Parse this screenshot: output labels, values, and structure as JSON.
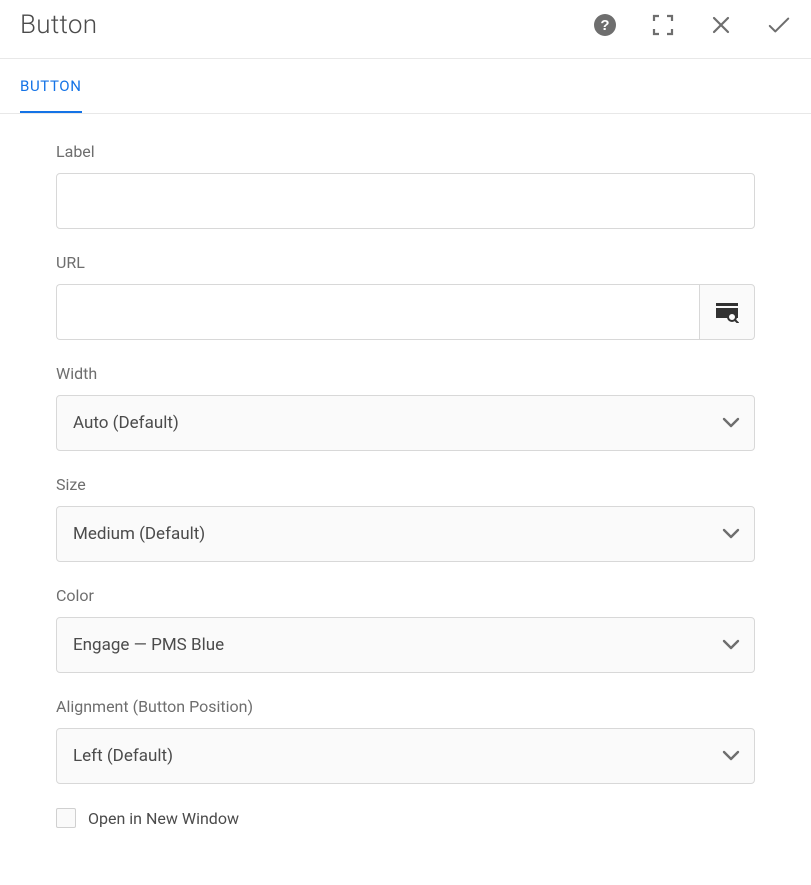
{
  "header": {
    "title": "Button"
  },
  "tabs": [
    {
      "label": "BUTTON",
      "active": true
    }
  ],
  "fields": {
    "label": {
      "label": "Label",
      "value": ""
    },
    "url": {
      "label": "URL",
      "value": ""
    },
    "width": {
      "label": "Width",
      "value": "Auto (Default)"
    },
    "size": {
      "label": "Size",
      "value": "Medium (Default)"
    },
    "color": {
      "label": "Color",
      "value": "Engage — PMS Blue"
    },
    "alignment": {
      "label": "Alignment (Button Position)",
      "value": "Left (Default)"
    },
    "newWindow": {
      "label": "Open in New Window",
      "checked": false
    }
  }
}
